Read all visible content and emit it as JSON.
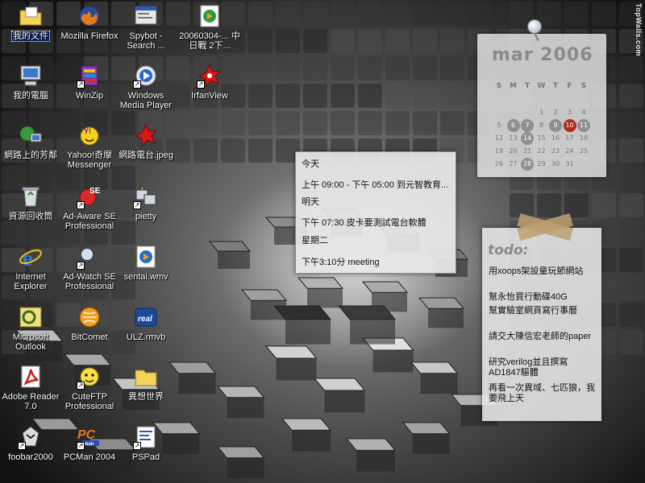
{
  "desktop": {
    "watermark": "TopWalls.com",
    "icons": [
      {
        "label": "我的文件",
        "icon": "folder-docs-icon",
        "selected": true,
        "shortcut": false
      },
      {
        "label": "我的電腦",
        "icon": "computer-icon",
        "shortcut": false
      },
      {
        "label": "網路上的芳鄰",
        "icon": "network-icon",
        "shortcut": false
      },
      {
        "label": "資源回收筒",
        "icon": "recycle-bin-icon",
        "shortcut": false
      },
      {
        "label": "Internet Explorer",
        "icon": "ie-icon",
        "shortcut": false
      },
      {
        "label": "Microsoft Outlook",
        "icon": "outlook-icon",
        "shortcut": false
      },
      {
        "label": "Adobe Reader 7.0",
        "icon": "adobe-reader-icon",
        "shortcut": false
      },
      {
        "label": "foobar2000",
        "icon": "foobar-icon",
        "shortcut": true
      },
      {
        "label": "Mozilla Firefox",
        "icon": "firefox-icon",
        "shortcut": false
      },
      {
        "label": "WinZip",
        "icon": "winzip-icon",
        "shortcut": true
      },
      {
        "label": "Yahoo!奇摩 Messenger",
        "icon": "yahoo-messenger-icon",
        "shortcut": false
      },
      {
        "label": "Ad-Aware SE Professional",
        "icon": "adaware-icon",
        "shortcut": true
      },
      {
        "label": "Ad-Watch SE Professional",
        "icon": "adwatch-icon",
        "shortcut": true
      },
      {
        "label": "BitComet",
        "icon": "bitcomet-icon",
        "shortcut": false
      },
      {
        "label": "CuteFTP Professional",
        "icon": "cuteftp-icon",
        "shortcut": true
      },
      {
        "label": "PCMan 2004",
        "icon": "pcman-icon",
        "shortcut": true
      },
      {
        "label": "Spybot - Search ...",
        "icon": "spybot-icon",
        "shortcut": false
      },
      {
        "label": "Windows Media Player",
        "icon": "media-player-icon",
        "shortcut": true
      },
      {
        "label": "網路電台.jpeg",
        "icon": "image-file-icon",
        "shortcut": false
      },
      {
        "label": "pietty",
        "icon": "pietty-icon",
        "shortcut": true
      },
      {
        "label": "sentai.wmv",
        "icon": "video-file-icon",
        "shortcut": false
      },
      {
        "label": "ULZ.rmvb",
        "icon": "real-file-icon",
        "shortcut": false
      },
      {
        "label": "異想世界",
        "icon": "folder-icon",
        "shortcut": false
      },
      {
        "label": "PSPad",
        "icon": "pspad-icon",
        "shortcut": true
      },
      {
        "label": "20060304-... 中日戰 2下...",
        "icon": "media-file-icon",
        "shortcut": false
      },
      {
        "label": "IrfanView",
        "icon": "irfanview-icon",
        "shortcut": true
      }
    ]
  },
  "calendar": {
    "month_label": "mar 2006",
    "weekdays": [
      "S",
      "M",
      "T",
      "W",
      "T",
      "F",
      "S"
    ],
    "weeks": [
      [
        "",
        "",
        "",
        "1",
        "2",
        "3",
        "4"
      ],
      [
        "5",
        "6",
        "7",
        "8",
        "9",
        "10",
        "11"
      ],
      [
        "12",
        "13",
        "14",
        "15",
        "16",
        "17",
        "18"
      ],
      [
        "19",
        "20",
        "21",
        "22",
        "23",
        "24",
        "25"
      ],
      [
        "26",
        "27",
        "28",
        "29",
        "30",
        "31",
        ""
      ]
    ],
    "marked_days": [
      "6",
      "7",
      "9",
      "11",
      "14",
      "28"
    ],
    "today": "10",
    "today_color": "#b02a1a"
  },
  "agenda": {
    "rows": [
      {
        "type": "head",
        "text": "今天"
      },
      {
        "type": "item",
        "text": "上午 09:00 - 下午 05:00 到元智教育..."
      },
      {
        "type": "head",
        "text": "明天"
      },
      {
        "type": "item",
        "text": "下午 07:30 皮卡要測試電台軟體"
      },
      {
        "type": "head",
        "text": "星期二"
      },
      {
        "type": "item",
        "text": "下午3:10分 meeting"
      }
    ]
  },
  "todo": {
    "title": "todo:",
    "items": [
      "用xoops架設童玩節網站",
      "幫永怡買行動碟40G",
      "幫實驗室網頁寫行事曆",
      "請交大陳信宏老師的paper",
      "研究verilog並且撰寫AD1847驅體",
      "再看一次異域、七匹狼，我要飛上天"
    ]
  }
}
